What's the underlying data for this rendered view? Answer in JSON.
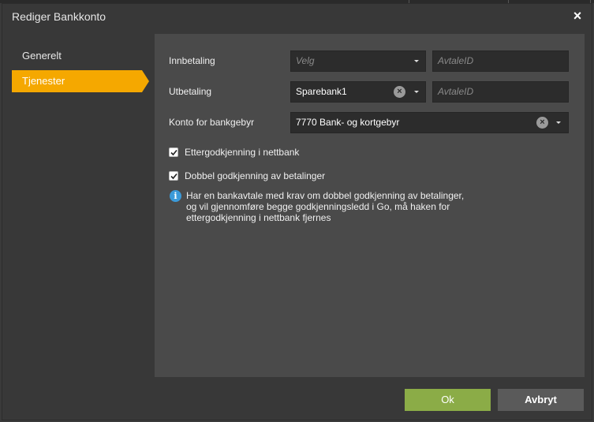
{
  "dialog": {
    "title": "Rediger Bankkonto",
    "close_label": "×"
  },
  "nav": {
    "items": [
      {
        "label": "Generelt",
        "active": false
      },
      {
        "label": "Tjenester",
        "active": true
      }
    ]
  },
  "form": {
    "innbetaling": {
      "label": "Innbetaling",
      "select_placeholder": "Velg",
      "avtale_placeholder": "AvtaleID"
    },
    "utbetaling": {
      "label": "Utbetaling",
      "select_value": "Sparebank1",
      "avtale_placeholder": "AvtaleID"
    },
    "gebyr": {
      "label": "Konto for bankgebyr",
      "select_value": "7770 Bank- og kortgebyr"
    },
    "checkboxes": [
      {
        "label": "Ettergodkjenning i nettbank",
        "checked": true
      },
      {
        "label": "Dobbel godkjenning av betalinger",
        "checked": true
      }
    ],
    "info": {
      "icon": "info-icon",
      "lines": [
        "Har en bankavtale med krav om dobbel godkjenning av betalinger,",
        "og vil gjennomføre begge godkjenningsledd i Go, må haken for",
        "ettergodkjenning i nettbank fjernes"
      ]
    }
  },
  "buttons": {
    "ok": "Ok",
    "cancel": "Avbryt"
  },
  "colors": {
    "accent": "#f5a800",
    "ok": "#8bac47",
    "info": "#3b9ad9"
  }
}
